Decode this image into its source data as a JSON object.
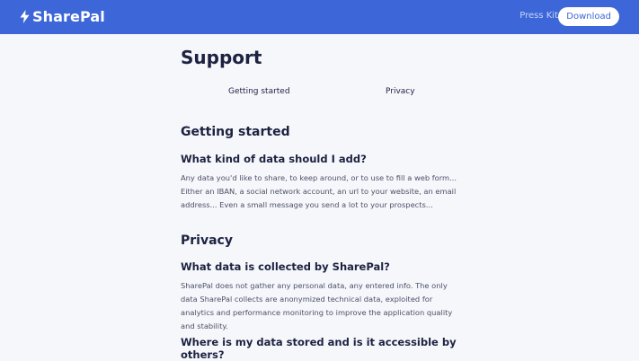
{
  "header": {
    "brand": "SharePal",
    "press_kit": "Press Kit",
    "download": "Download"
  },
  "page": {
    "title": "Support",
    "toc": [
      "Getting started",
      "Privacy"
    ]
  },
  "sections": [
    {
      "title": "Getting started",
      "faqs": [
        {
          "question": "What kind of data should I add?",
          "answer": "Any data you'd like to share, to keep around, or to use to fill a web form... Either an IBAN, a social network account, an url to your website, an email address... Even a small message you send a lot to your prospects..."
        }
      ]
    },
    {
      "title": "Privacy",
      "faqs": [
        {
          "question": "What data is collected by SharePal?",
          "answer": "SharePal does not gather any personal data, any entered info. The only data SharePal collects are anonymized technical data, exploited for analytics and performance monitoring to improve the application quality and stability."
        },
        {
          "question": "Where is my data stored and is it accessible by others?",
          "answer": ""
        }
      ]
    }
  ],
  "colors": {
    "header_bg": "#3d67d8",
    "page_bg": "#f6f7fb",
    "heading": "#1c2240",
    "body_text": "#4b5068"
  },
  "icons": {
    "brand": "lightning-bolt-icon"
  }
}
